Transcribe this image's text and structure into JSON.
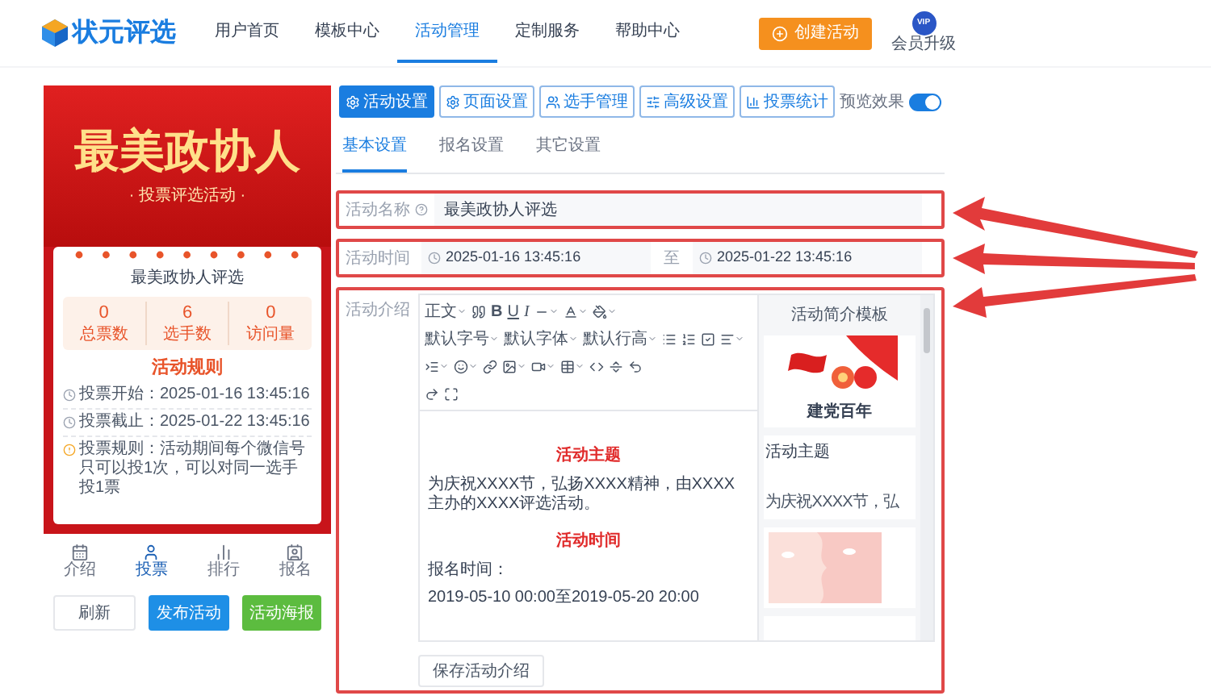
{
  "header": {
    "logo": "状元评选",
    "nav": [
      {
        "label": "用户首页",
        "selected": false
      },
      {
        "label": "模板中心",
        "selected": false
      },
      {
        "label": "活动管理",
        "selected": true
      },
      {
        "label": "定制服务",
        "selected": false
      },
      {
        "label": "帮助中心",
        "selected": false
      }
    ],
    "create_button": "创建活动",
    "vip_badge": "VIP",
    "vip_label": "会员升级"
  },
  "preview": {
    "banner_title": "最美政协人",
    "banner_subtitle": "· 投票评选活动 ·",
    "card_title": "最美政协人评选",
    "stats": [
      {
        "value": "0",
        "label": "总票数"
      },
      {
        "value": "6",
        "label": "选手数"
      },
      {
        "value": "0",
        "label": "访问量"
      }
    ],
    "rules_title": "活动规则",
    "rules": [
      {
        "kind": "time",
        "label": "投票开始：",
        "text": "2025-01-16 13:45:16"
      },
      {
        "kind": "time",
        "label": "投票截止：",
        "text": "2025-01-22 13:45:16"
      },
      {
        "kind": "info",
        "label": "投票规则：",
        "text": "活动期间每个微信号只可以投1次，可以对同一选手投1票"
      }
    ],
    "tabbar": [
      {
        "label": "介绍",
        "selected": false
      },
      {
        "label": "投票",
        "selected": true
      },
      {
        "label": "排行",
        "selected": false
      },
      {
        "label": "报名",
        "selected": false
      }
    ],
    "buttons": [
      {
        "label": "刷新",
        "kind": "plain"
      },
      {
        "label": "发布活动",
        "kind": "primary"
      },
      {
        "label": "活动海报",
        "kind": "success"
      }
    ]
  },
  "settings": {
    "tabs": [
      {
        "label": "活动设置",
        "selected": true
      },
      {
        "label": "页面设置",
        "selected": false
      },
      {
        "label": "选手管理",
        "selected": false
      },
      {
        "label": "高级设置",
        "selected": false
      },
      {
        "label": "投票统计",
        "selected": false
      }
    ],
    "preview_toggle": {
      "label": "预览效果",
      "on": true
    },
    "subtabs": [
      {
        "label": "基本设置",
        "selected": true
      },
      {
        "label": "报名设置",
        "selected": false
      },
      {
        "label": "其它设置",
        "selected": false
      }
    ],
    "name_field": {
      "label": "活动名称",
      "value": "最美政协人评选"
    },
    "time_field": {
      "label": "活动时间",
      "start": "2025-01-16 13:45:16",
      "separator": "至",
      "end": "2025-01-22 13:45:16"
    },
    "intro": {
      "label": "活动介绍",
      "toolbar": [
        [
          {
            "kind": "select",
            "label": "正文"
          },
          {
            "kind": "icon"
          },
          {
            "kind": "bold",
            "label": "B"
          },
          {
            "kind": "underline",
            "label": "U"
          },
          {
            "kind": "italic",
            "label": "I"
          },
          {
            "kind": "menu"
          },
          {
            "kind": "menu"
          },
          {
            "kind": "menu"
          }
        ],
        [
          {
            "kind": "select",
            "label": "默认字号"
          },
          {
            "kind": "select",
            "label": "默认字体"
          },
          {
            "kind": "select",
            "label": "默认行高"
          },
          {
            "kind": "icon"
          },
          {
            "kind": "icon"
          },
          {
            "kind": "icon"
          },
          {
            "kind": "menu"
          }
        ],
        [
          {
            "kind": "menu"
          },
          {
            "kind": "menu"
          },
          {
            "kind": "icon"
          },
          {
            "kind": "menu"
          },
          {
            "kind": "menu"
          },
          {
            "kind": "menu"
          },
          {
            "kind": "icon"
          },
          {
            "kind": "icon"
          },
          {
            "kind": "icon"
          }
        ],
        [
          {
            "kind": "icon"
          },
          {
            "kind": "icon"
          }
        ]
      ],
      "content": [
        {
          "kind": "heading",
          "text": "活动主题"
        },
        {
          "kind": "paragraph",
          "text": "为庆祝XXXX节，弘扬XXXX精神，由XXXX主办的XXXX评选活动。"
        },
        {
          "kind": "heading",
          "text": "活动时间"
        },
        {
          "kind": "paragraph",
          "text": "报名时间："
        },
        {
          "kind": "paragraph",
          "text": "2019-05-10 00:00至2019-05-20 20:00"
        }
      ],
      "templates_title": "活动简介模板",
      "templates": [
        {
          "kind": "festive",
          "caption": "建党百年"
        },
        {
          "kind": "text",
          "title": "活动主题",
          "snippet": "为庆祝XXXX节，弘"
        },
        {
          "kind": "pink"
        },
        {
          "kind": "blank"
        }
      ],
      "save_button": "保存活动介绍"
    }
  }
}
